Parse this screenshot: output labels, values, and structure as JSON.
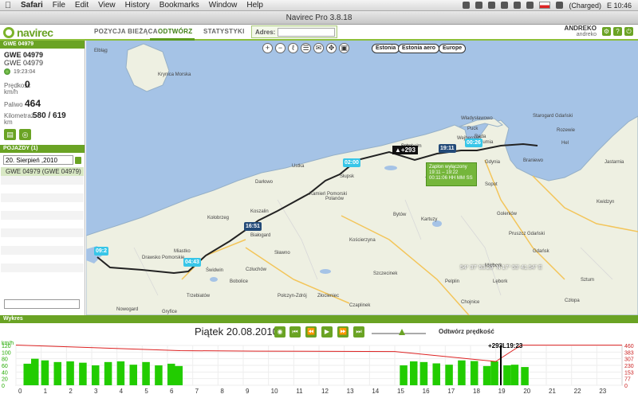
{
  "os_menubar": {
    "app_name": "Safari",
    "menus": [
      "File",
      "Edit",
      "View",
      "History",
      "Bookmarks",
      "Window",
      "Help"
    ],
    "battery": "(Charged)",
    "clock": "E 10:46"
  },
  "window": {
    "title": "Navirec Pro 3.8.18"
  },
  "header": {
    "logo": "navirec",
    "tabs": [
      "POZYCJA BIEŻĄCA",
      "ODTWÓRZ",
      "STATYSTYKI"
    ],
    "active_tab": "ODTWÓRZ",
    "address_label": "Adres:",
    "address_value": "",
    "user_name": "ANDREKO",
    "user_sub": "andreko"
  },
  "vehicle": {
    "section_title": "GWE 04979",
    "name": "GWE 04979",
    "sub": "GWE 04979",
    "time": "19:23:04",
    "speed_label": "Prędkość km/h",
    "speed_value": "0",
    "fuel_label": "Paliwo",
    "fuel_value": "464",
    "odometer_label": "Kilometraż km",
    "odometer_value": "580 / 619"
  },
  "vehicles_panel": {
    "title": "POJAZDY (1)",
    "date_value": "20. Sierpień ,2010",
    "items": [
      "GWE 04979 (GWE 04979)"
    ]
  },
  "map": {
    "layer_buttons": [
      "Estonia",
      "Estonia aero",
      "Europe"
    ],
    "time_tags": [
      "09:2",
      "04:43",
      "16:51",
      "02:00",
      "19:11",
      "00:26"
    ],
    "speed_tag": "+293",
    "ignition": [
      "Zapłon wyłączony",
      "19:11 – 19:22",
      "00:11:06 HH MM SS"
    ],
    "coords": "54° 37' 53.29\" N 17° 53' 41.54\" E",
    "towns": [
      "Łeba",
      "Władysławowo",
      "Puck",
      "Reda",
      "Wejherowo",
      "Rumia",
      "Gdynia",
      "Ustka",
      "Słupsk",
      "Darłowo",
      "Koszalin",
      "Kołobrzeg",
      "Białogard",
      "Świdwin",
      "Szczecinek",
      "Bytów",
      "Kartuzy",
      "Kościerzyna",
      "Miastko",
      "Trzebiatów",
      "Gryfice",
      "Nowogard",
      "Goleniów",
      "Pruszcz Gdański",
      "Tczew",
      "Lębork",
      "Pelplin",
      "Chojnice",
      "Człuchów",
      "Drawsko Pomorskie",
      "Kamień Pomorski",
      "Polanów",
      "Sławno",
      "Bobolice",
      "Połczyn-Zdrój",
      "Złocieniec",
      "Czaplinek",
      "Człopa",
      "Sztum",
      "Kwidzyn",
      "Elbląg",
      "Braniewo",
      "Sopot",
      "Gdańsk",
      "Malbork",
      "Starogard Gdański",
      "Rozewie",
      "Hel",
      "Jastarnia",
      "Krynica Morska",
      "Bornholm"
    ]
  },
  "player": {
    "section_title": "Wykres",
    "date": "Piątek 20.08.2010",
    "speed_label": "Odtwórz prędkość"
  },
  "chart_data": {
    "type": "area",
    "x_ticks": [
      "0",
      "1",
      "2",
      "3",
      "4",
      "5",
      "6",
      "7",
      "8",
      "9",
      "10",
      "11",
      "12",
      "13",
      "14",
      "15",
      "16",
      "17",
      "18",
      "19",
      "20",
      "21",
      "22",
      "23"
    ],
    "y_left_label": "km/h",
    "y_left_ticks": [
      "0",
      "20",
      "40",
      "60",
      "80",
      "100",
      "120"
    ],
    "y_right_ticks": [
      "0",
      "77",
      "153",
      "230",
      "307",
      "383",
      "460"
    ],
    "annotation": "+293L19:23",
    "series": [
      {
        "kind": "speed",
        "color": "#22cc00",
        "x": [
          0.3,
          0.6,
          1.0,
          1.5,
          2.0,
          2.5,
          3.0,
          3.5,
          4.0,
          4.5,
          5.0,
          5.5,
          6.0,
          6.3,
          15.2,
          15.6,
          16.0,
          16.5,
          17.0,
          17.5,
          18.0,
          18.5,
          18.8,
          19.3,
          19.6,
          20.0
        ],
        "values": [
          65,
          80,
          75,
          70,
          72,
          68,
          60,
          70,
          72,
          62,
          70,
          60,
          65,
          58,
          60,
          72,
          70,
          66,
          62,
          75,
          73,
          58,
          72,
          60,
          62,
          55
        ]
      },
      {
        "kind": "fuel",
        "color": "#dd2222",
        "x": [
          0,
          6.5,
          9.5,
          15,
          19,
          20,
          24
        ],
        "values": [
          465,
          400,
          395,
          390,
          275,
          464,
          464
        ]
      }
    ]
  }
}
